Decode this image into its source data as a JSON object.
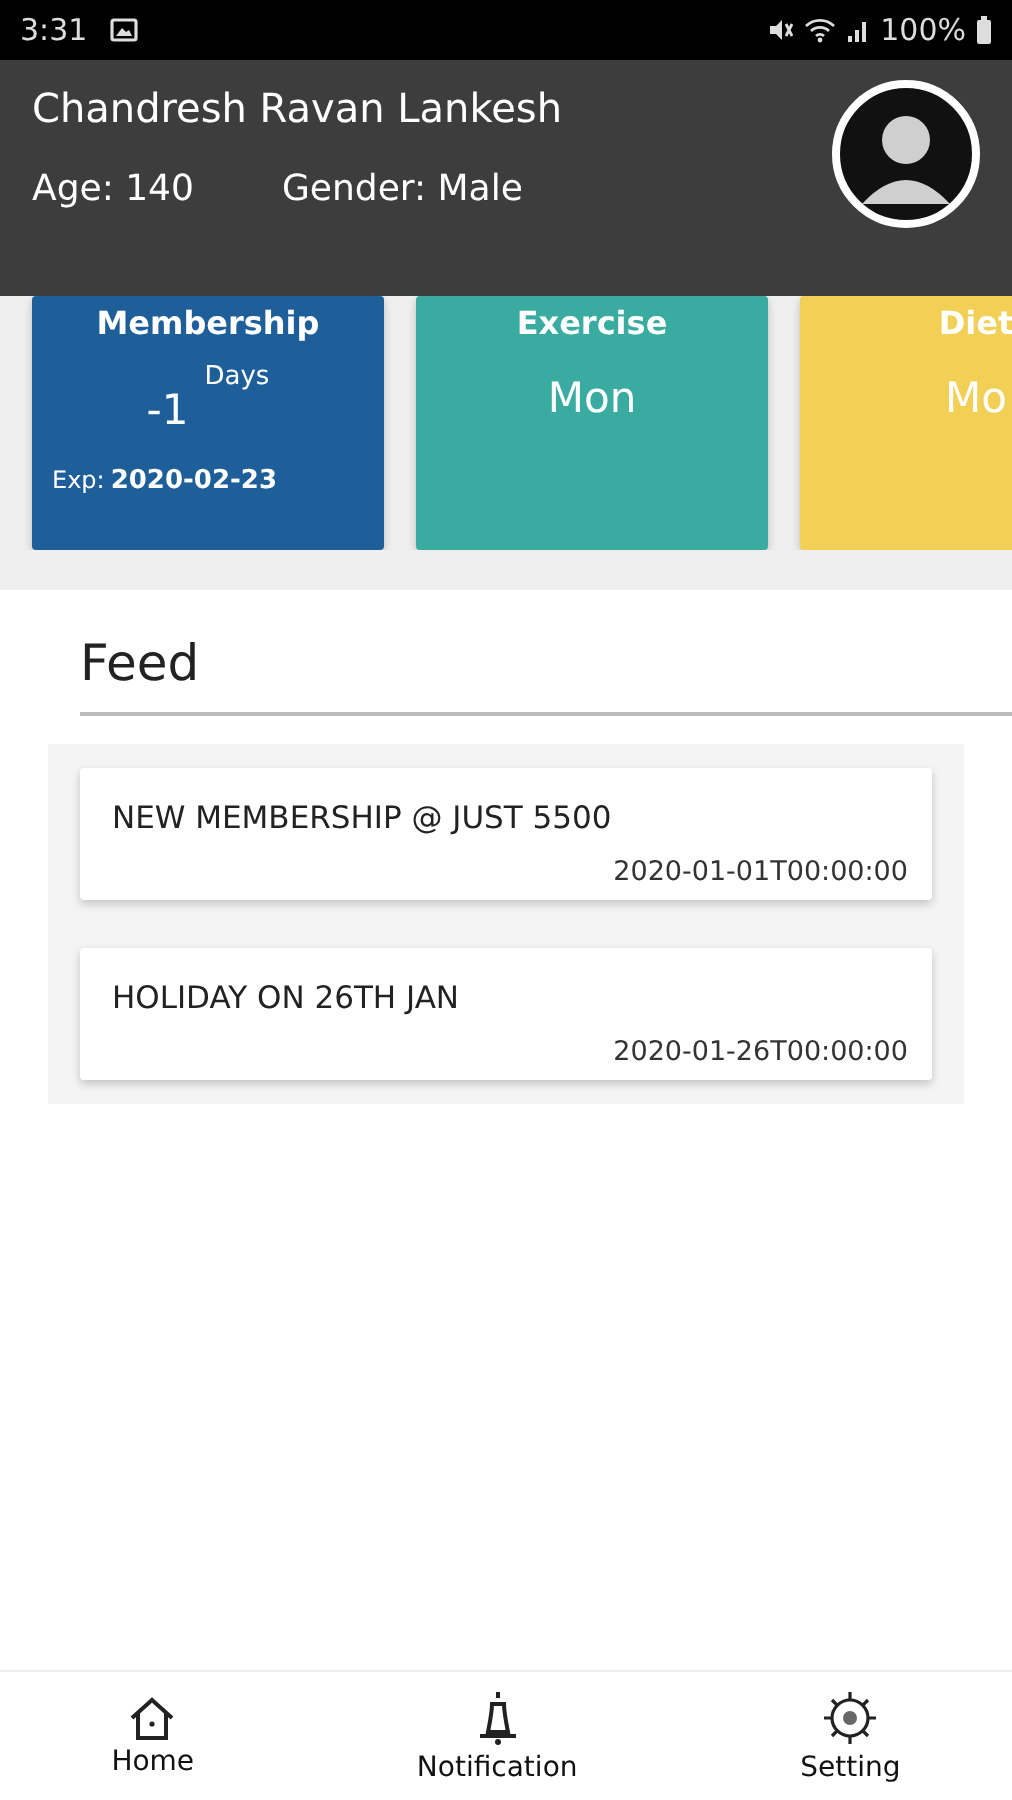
{
  "status_bar": {
    "time": "3:31",
    "battery": "100%"
  },
  "profile": {
    "name": "Chandresh Ravan Lankesh",
    "age": "Age: 140",
    "gender": "Gender: Male"
  },
  "cards": [
    {
      "kind": "membership",
      "title": "Membership",
      "value": "-1",
      "unit": "Days",
      "expiry_label": "Exp:",
      "expiry": "2020-02-23",
      "color": "#1f5f99"
    },
    {
      "kind": "plain",
      "title": "Exercise",
      "value": "Mon",
      "color": "#3aaba0"
    },
    {
      "kind": "plain",
      "title": "Diet",
      "value": "Mo",
      "color": "#f2cf55"
    }
  ],
  "feed": {
    "title": "Feed",
    "items": [
      {
        "text": "NEW MEMBERSHIP @ JUST 5500",
        "date": "2020-01-01T00:00:00"
      },
      {
        "text": "HOLIDAY ON 26TH JAN",
        "date": "2020-01-26T00:00:00"
      }
    ]
  },
  "nav": [
    {
      "kind": "home",
      "label": "Home"
    },
    {
      "kind": "bell",
      "label": "Notification"
    },
    {
      "kind": "gear",
      "label": "Setting"
    }
  ]
}
